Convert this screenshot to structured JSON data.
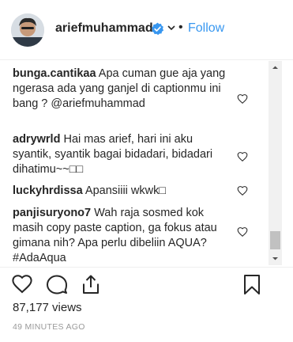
{
  "header": {
    "username": "ariefmuhammad",
    "separator": "•",
    "follow_label": "Follow"
  },
  "comments": [
    {
      "user": "bunga.cantikaa",
      "text": "Apa cuman gue aja yang ngerasa ada yang ganjel di captionmu ini bang ?",
      "mention": "@ariefmuhammad"
    },
    {
      "user": "adrywrld",
      "text": "Hai mas arief, hari ini aku syantik, syantik bagai bidadari, bidadari dihatimu~~□□",
      "mention": ""
    },
    {
      "user": "luckyhrdissa",
      "text": "Apansiiii wkwk□",
      "mention": ""
    },
    {
      "user": "panjisuryono7",
      "text": "Wah raja sosmed kok masih copy paste caption, ga fokus atau gimana nih? Apa perlu dibeliin AQUA?",
      "mention": "#AdaAqua"
    }
  ],
  "stats": {
    "views": "87,177 views",
    "timestamp": "49 MINUTES AGO"
  },
  "colors": {
    "accent": "#3897f0",
    "verified": "#3897f0",
    "text": "#262626",
    "muted": "#999999"
  },
  "icons": {
    "verified": "verified-badge-icon",
    "dropdown": "chevron-down-icon",
    "like": "heart-icon",
    "comment": "speech-bubble-icon",
    "share": "share-icon",
    "save": "bookmark-icon"
  }
}
